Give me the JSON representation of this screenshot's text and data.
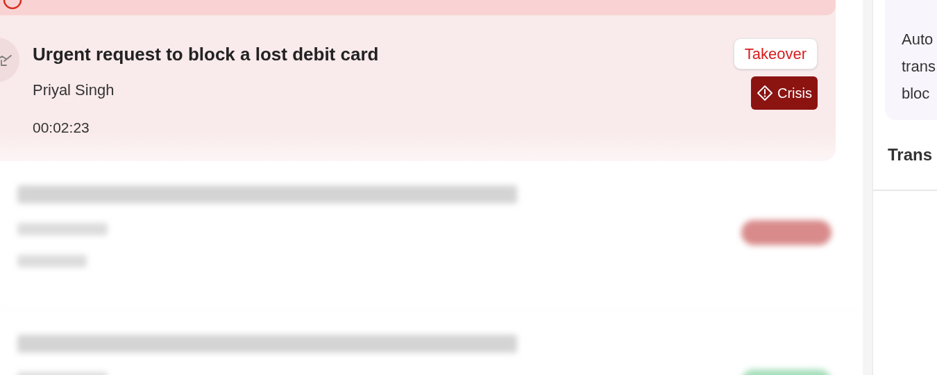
{
  "active_case": {
    "title": "Urgent request to block a lost debit card",
    "customer": "Priyal Singh",
    "duration": "00:02:23",
    "takeover_button": "Takeover",
    "badge": "Crisis"
  },
  "blurred_cases": [
    {
      "color": "#d98b8b"
    },
    {
      "color": "#a6dfbb"
    }
  ],
  "side_panel": {
    "summary_lines": [
      "Auto",
      "trans",
      "bloc"
    ],
    "section_title": "Trans"
  }
}
